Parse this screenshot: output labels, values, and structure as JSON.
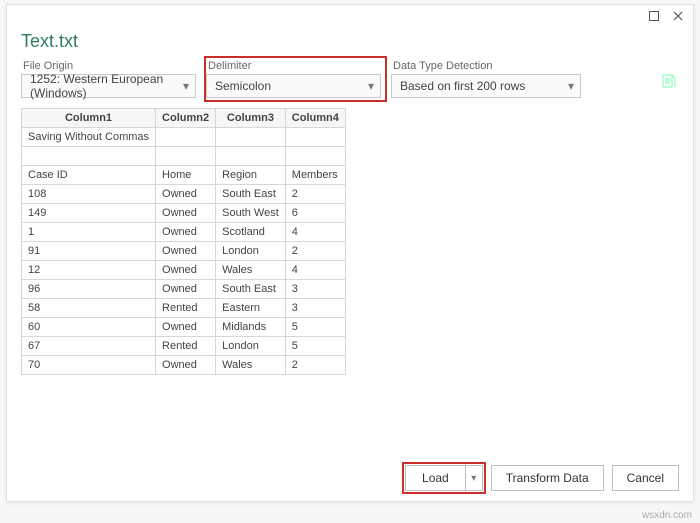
{
  "window": {
    "title": "Text.txt"
  },
  "options": {
    "origin": {
      "label": "File Origin",
      "value": "1252: Western European (Windows)"
    },
    "delimiter": {
      "label": "Delimiter",
      "value": "Semicolon"
    },
    "detection": {
      "label": "Data Type Detection",
      "value": "Based on first 200 rows"
    }
  },
  "preview": {
    "headers": [
      "Column1",
      "Column2",
      "Column3",
      "Column4"
    ],
    "rows": [
      [
        "Saving Without Commas",
        "",
        "",
        ""
      ],
      [
        "",
        "",
        "",
        ""
      ],
      [
        "Case ID",
        "Home",
        "Region",
        "Members"
      ],
      [
        "108",
        "Owned",
        "South East",
        "2"
      ],
      [
        "149",
        "Owned",
        "South West",
        "6"
      ],
      [
        "1",
        "Owned",
        "Scotland",
        "4"
      ],
      [
        "91",
        "Owned",
        "London",
        "2"
      ],
      [
        "12",
        "Owned",
        "Wales",
        "4"
      ],
      [
        "96",
        "Owned",
        "South East",
        "3"
      ],
      [
        "58",
        "Rented",
        "Eastern",
        "3"
      ],
      [
        "60",
        "Owned",
        "Midlands",
        "5"
      ],
      [
        "67",
        "Rented",
        "London",
        "5"
      ],
      [
        "70",
        "Owned",
        "Wales",
        "2"
      ]
    ]
  },
  "footer": {
    "load": "Load",
    "transform": "Transform Data",
    "cancel": "Cancel"
  },
  "watermark": "wsxdn.com"
}
